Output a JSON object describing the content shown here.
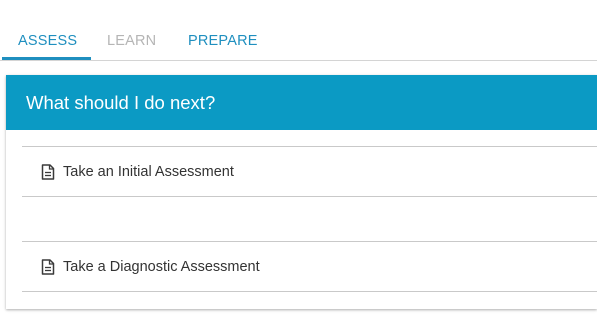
{
  "tabs": [
    {
      "label": "ASSESS",
      "state": "active"
    },
    {
      "label": "LEARN",
      "state": "disabled"
    },
    {
      "label": "PREPARE",
      "state": "link"
    }
  ],
  "card": {
    "title": "What should I do next?",
    "items": [
      {
        "label": "Take an Initial Assessment",
        "icon": "document-icon"
      },
      {
        "label": "Take a Diagnostic Assessment",
        "icon": "document-icon"
      }
    ]
  },
  "colors": {
    "accent": "#1f8fbf",
    "header_bg": "#0b9ac4",
    "inactive_tab": "#b5b5b5"
  }
}
